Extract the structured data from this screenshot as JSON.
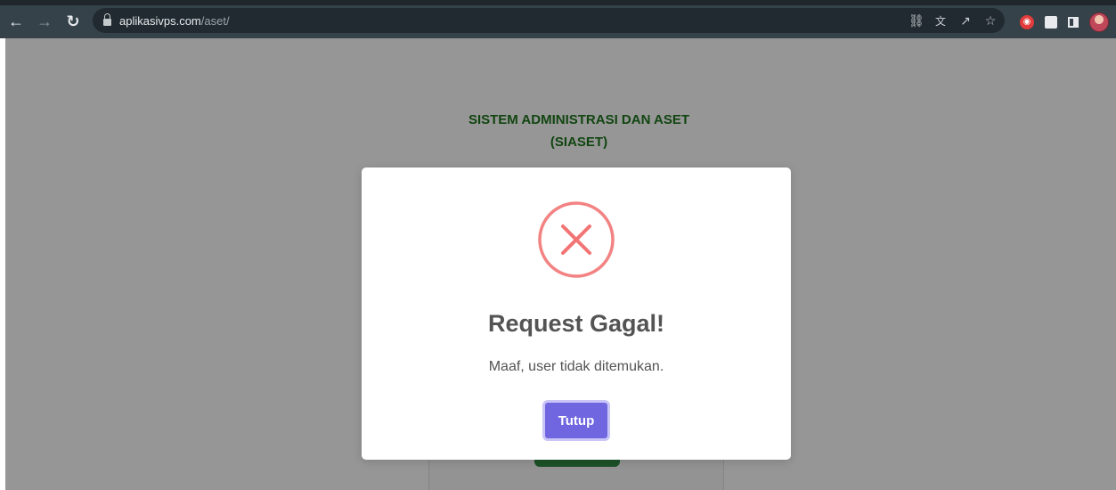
{
  "browser": {
    "url_domain": "aplikasivps.com",
    "url_path": "/aset/",
    "icons": {
      "back": "back-arrow-icon",
      "forward": "forward-arrow-icon",
      "reload": "reload-icon",
      "lock": "lock-icon",
      "password": "key-icon",
      "translate": "translate-icon",
      "share": "share-icon",
      "bookmark": "star-icon",
      "extension": "extension-icon",
      "extensions": "puzzle-icon",
      "side_panel": "side-panel-icon",
      "profile": "avatar"
    }
  },
  "page": {
    "title_line1": "SISTEM ADMINISTRASI DAN ASET",
    "title_line2": "(SIASET)",
    "title_color": "#006400"
  },
  "modal": {
    "icon": "error-x-icon",
    "icon_color": "#f27474",
    "title": "Request Gagal!",
    "message": "Maaf, user tidak ditemukan.",
    "button_label": "Tutup",
    "button_color": "#7066e0"
  }
}
